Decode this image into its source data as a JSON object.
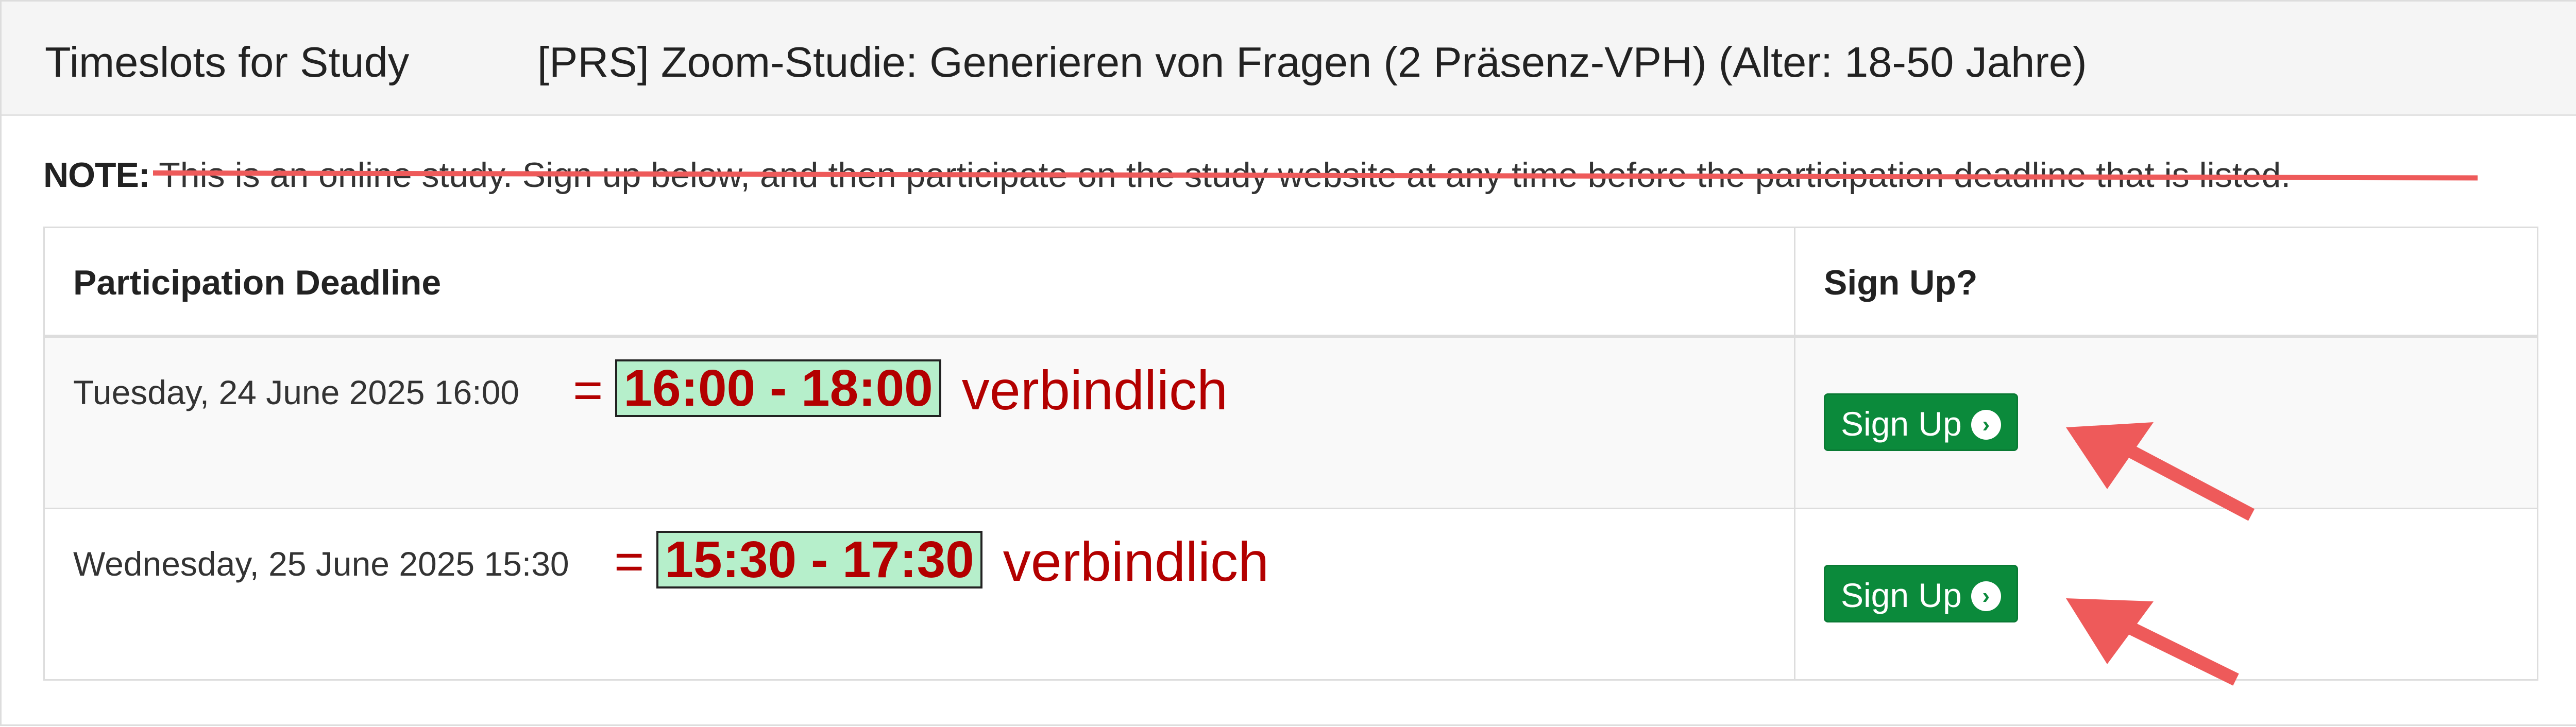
{
  "header": {
    "label": "Timeslots for Study",
    "study_name": "[PRS] Zoom-Studie: Generieren von Fragen (2 Präsenz-VPH) (Alter: 18-50 Jahre)"
  },
  "note": {
    "label": "NOTE:",
    "text": " This is an online study. Sign up below, and then participate on the study website at any time before the participation deadline that is listed.",
    "strikethrough_color": "#ee5a5a"
  },
  "table": {
    "headers": [
      "Participation Deadline",
      "Sign Up?"
    ],
    "rows": [
      {
        "deadline": "Tuesday, 24 June 2025 16:00",
        "annotation_eq": "=",
        "annotation_time": "16:00 - 18:00",
        "annotation_word": "verbindlich",
        "button_label": "Sign Up",
        "button_icon": "chevron-circle-right-icon"
      },
      {
        "deadline": "Wednesday, 25 June 2025 15:30",
        "annotation_eq": "=",
        "annotation_time": "15:30 - 17:30",
        "annotation_word": "verbindlich",
        "button_label": "Sign Up",
        "button_icon": "chevron-circle-right-icon"
      }
    ]
  },
  "colors": {
    "button_green": "#0b8a3b",
    "annotation_red": "#b30000",
    "time_highlight": "#b6efcb",
    "arrow_red": "#ee5a5a"
  }
}
